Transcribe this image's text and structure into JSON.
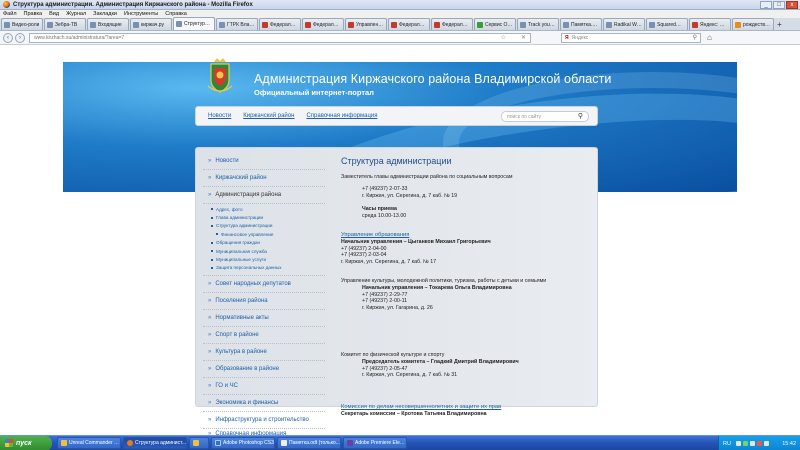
{
  "window": {
    "title": "Структура администрации. Администрация Киржачского района - Mozilla Firefox",
    "controls": {
      "minimize": "_",
      "maximize": "□",
      "close": "x"
    }
  },
  "menubar": {
    "items": [
      "Файл",
      "Правка",
      "Вид",
      "Журнал",
      "Закладки",
      "Инструменты",
      "Справка"
    ]
  },
  "tabs": [
    {
      "label": "Видео-роли",
      "icon": "blue"
    },
    {
      "label": "Зебра-ТВ",
      "icon": "blue"
    },
    {
      "label": "Входящие",
      "icon": "blue"
    },
    {
      "label": "киржач.ру",
      "icon": "blue"
    },
    {
      "label": "Структура ...",
      "icon": "blue",
      "active": true
    },
    {
      "label": "ГТРК Влади...",
      "icon": "blue"
    },
    {
      "label": "Федеральна...",
      "icon": "red"
    },
    {
      "label": "Федеральна...",
      "icon": "red"
    },
    {
      "label": "Управление ...",
      "icon": "red"
    },
    {
      "label": "Федеральна...",
      "icon": "red"
    },
    {
      "label": "Федеральна...",
      "icon": "red"
    },
    {
      "label": "Сервис Отсл...",
      "icon": "green"
    },
    {
      "label": "Track your p...",
      "icon": "blue"
    },
    {
      "label": "Памятка.odt",
      "icon": "blue"
    },
    {
      "label": "Radikal Wea...",
      "icon": "blue"
    },
    {
      "label": "SquaredMail",
      "icon": "blue"
    },
    {
      "label": "Яндекс: Мет...",
      "icon": "red"
    },
    {
      "label": "рождество ...",
      "icon": "orange"
    }
  ],
  "tab_new": "+",
  "navbar": {
    "back": "‹",
    "forward": "›",
    "url": "www.kirzhach.su/administratura/?area=7",
    "star": "☆",
    "reload": "✕",
    "search_engine": "Я",
    "search_placeholder": "Яндекс",
    "search_icon": "⚲",
    "home": "⌂"
  },
  "site": {
    "title": "Администрация Киржачского района Владимирской области",
    "subtitle": "Официальный интернет-портал",
    "topnav": [
      "Новости",
      "Киржачский район",
      "Справочная информация"
    ],
    "search_placeholder": "поиск по сайту",
    "search_icon": "⚲"
  },
  "sidebar": {
    "items_top": [
      "Новости",
      "Киржачский район"
    ],
    "current": "Администрация района",
    "subitems": [
      {
        "label": "Адрес, фото",
        "level": 1
      },
      {
        "label": "Глава администрации",
        "level": 1
      },
      {
        "label": "Структура администрации",
        "level": 1
      },
      {
        "label": "Финансовое управление",
        "level": 2
      },
      {
        "label": "Обращения граждан",
        "level": 1
      },
      {
        "label": "Муниципальная служба",
        "level": 1
      },
      {
        "label": "Муниципальные услуги",
        "level": 1
      },
      {
        "label": "Защита персональных данных",
        "level": 1
      }
    ],
    "items_bottom": [
      "Совет народных депутатов",
      "Поселения района",
      "Нормативные акты",
      "Спорт в районе",
      "Культура в районе",
      "Образование в районе",
      "ГО и ЧС",
      "Экономика и финансы",
      "Инфраструктура и строительство",
      "Справочная информация"
    ]
  },
  "main": {
    "heading": "Структура администрации",
    "deputy": {
      "title": "Заместитель главы администрации района по социальным вопросам",
      "phone": "+7 (49237) 2-07-33",
      "address": "г. Киржач, ул. Серегина, д. 7 каб. № 19",
      "hours_label": "Часы приема",
      "hours": "среда 10.00-13.00"
    },
    "education": {
      "link": "Управление образования",
      "head": "Начальник управления – Цыганков Михаил Григорьевич",
      "phones": [
        "+7 (49237) 2-04-00",
        "+7 (49237) 2-03-04"
      ],
      "address": "г. Киржач, ул. Серегина, д. 7 каб. № 17"
    },
    "culture": {
      "title": "Управление культуры, молодежной политики, туризма, работы с детьми и семьями",
      "head": "Начальник управления – Токарева Ольга Владимировна",
      "phones": [
        "+7 (49237) 2-29-77",
        "+7 (49237) 2-00-11"
      ],
      "address": "г. Киржач, ул. Гагарина, д. 26"
    },
    "sport": {
      "title": "Комитет по физической культуре и спорту",
      "head": "Председатель комитета – Гладкий Дмитрий Владимирович",
      "phone": "+7 (49237) 2-05-47",
      "address": "г. Киржач, ул. Серегина, д. 7 каб. № 31"
    },
    "minors": {
      "link": "Комиссия по делам несовершеннолетних и защите их прав",
      "secretary": "Секретарь комиссии – Кротова Татьяна Владимировна"
    }
  },
  "taskbar": {
    "start": "пуск",
    "buttons": [
      {
        "label": "Unreal Commander v...",
        "icon": "folder"
      },
      {
        "label": "Структура админист...",
        "icon": "ff",
        "active": true
      },
      {
        "label": "",
        "icon": "folder"
      },
      {
        "label": "Adobe Photoshop CS3",
        "icon": "ps"
      },
      {
        "label": "Памятка.odt (только...",
        "icon": "doc"
      },
      {
        "label": "Adobe Premiere Elem...",
        "icon": "pr"
      }
    ],
    "tray": {
      "lang": "RU",
      "clock": "15:42"
    }
  }
}
